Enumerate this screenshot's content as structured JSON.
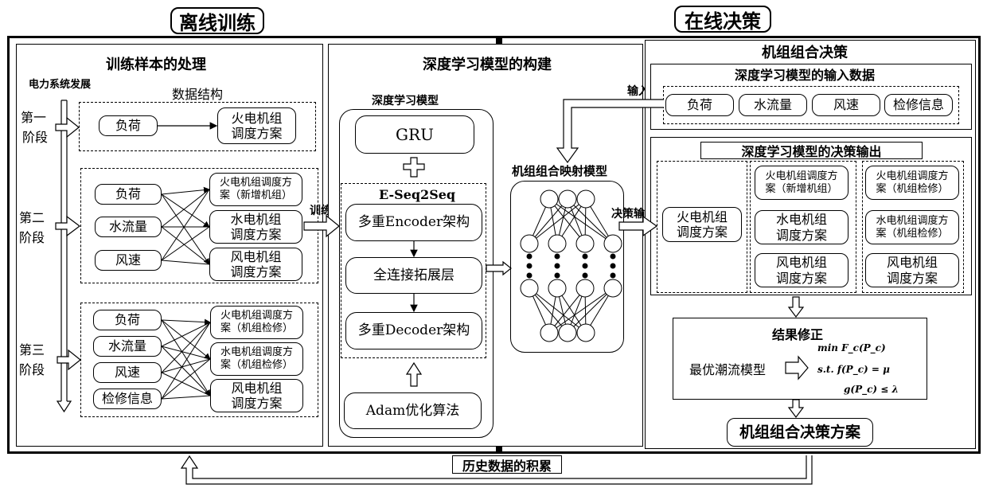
{
  "headers": {
    "offline": "离线训练",
    "online": "在线决策"
  },
  "offline": {
    "sample_processing": {
      "title": "训练样本的处理",
      "timeline_label": "电力系统发展",
      "data_structure_label": "数据结构",
      "stages": [
        {
          "label": "第一\n阶段",
          "label_l1": "第一",
          "label_l2": "阶段",
          "inputs": [
            "负荷"
          ],
          "outputs": [
            {
              "l1": "火电机组",
              "l2": "调度方案"
            }
          ]
        },
        {
          "label_l1": "第二",
          "label_l2": "阶段",
          "inputs": [
            "负荷",
            "水流量",
            "风速"
          ],
          "outputs": [
            {
              "l1": "火电机组调度方",
              "l2": "案（新增机组）"
            },
            {
              "l1": "水电机组",
              "l2": "调度方案"
            },
            {
              "l1": "风电机组",
              "l2": "调度方案"
            }
          ]
        },
        {
          "label_l1": "第三",
          "label_l2": "阶段",
          "inputs": [
            "负荷",
            "水流量",
            "风速",
            "检修信息"
          ],
          "outputs": [
            {
              "l1": "火电机组调度方",
              "l2": "案（机组检修）"
            },
            {
              "l1": "水电机组调度方",
              "l2": "案（机组检修）"
            },
            {
              "l1": "风电机组",
              "l2": "调度方案"
            }
          ]
        }
      ],
      "train_arrow_label": "训练"
    },
    "model_building": {
      "title": "深度学习模型的构建",
      "dl_model_label": "深度学习模型",
      "gru": "GRU",
      "eseq_label": "E-Seq2Seq",
      "encoder": "多重Encoder架构",
      "fc_layer": "全连接拓展层",
      "decoder": "多重Decoder架构",
      "optimizer": "Adam优化算法",
      "mapping_model_label": "机组组合映射模型",
      "input_arrow_label": "输入",
      "output_arrow_label": "决策输出"
    }
  },
  "online": {
    "title": "机组组合决策",
    "input_data": {
      "title": "深度学习模型的输入数据",
      "items": [
        "负荷",
        "水流量",
        "风速",
        "检修信息"
      ]
    },
    "decision_output": {
      "title": "深度学习模型的决策输出",
      "col1": [
        {
          "l1": "火电机组",
          "l2": "调度方案"
        }
      ],
      "col2": [
        {
          "l1": "火电机组调度方",
          "l2": "案（新增机组）"
        },
        {
          "l1": "水电机组",
          "l2": "调度方案"
        },
        {
          "l1": "风电机组",
          "l2": "调度方案"
        }
      ],
      "col3": [
        {
          "l1": "火电机组调度方",
          "l2": "案（机组检修）"
        },
        {
          "l1": "水电机组调度方",
          "l2": "案（机组检修）"
        },
        {
          "l1": "风电机组",
          "l2": "调度方案"
        }
      ]
    },
    "correction": {
      "title": "结果修正",
      "model_label": "最优潮流模型",
      "formula": [
        "min F_c(P_c)",
        "s.t.  f(P_c) = μ",
        "g(P_c) ≤ λ"
      ]
    },
    "final": "机组组合决策方案"
  },
  "feedback": {
    "label": "历史数据的积累"
  }
}
